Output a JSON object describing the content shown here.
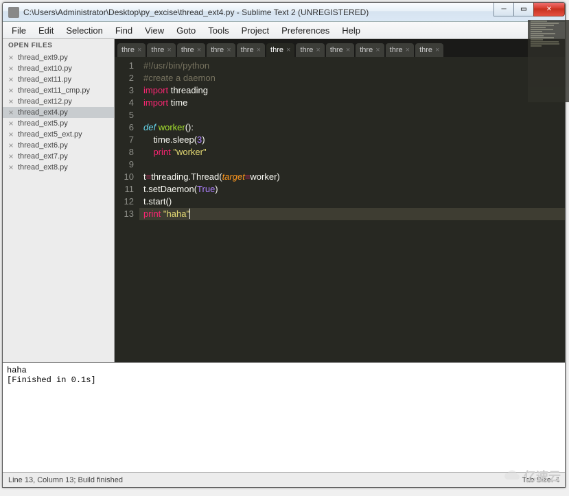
{
  "window": {
    "title": "C:\\Users\\Administrator\\Desktop\\py_excise\\thread_ext4.py - Sublime Text 2 (UNREGISTERED)"
  },
  "menu": {
    "items": [
      "File",
      "Edit",
      "Selection",
      "Find",
      "View",
      "Goto",
      "Tools",
      "Project",
      "Preferences",
      "Help"
    ]
  },
  "sidebar": {
    "header": "OPEN FILES",
    "items": [
      {
        "label": "thread_ext9.py",
        "active": false
      },
      {
        "label": "thread_ext10.py",
        "active": false
      },
      {
        "label": "thread_ext11.py",
        "active": false
      },
      {
        "label": "thread_ext11_cmp.py",
        "active": false
      },
      {
        "label": "thread_ext12.py",
        "active": false
      },
      {
        "label": "thread_ext4.py",
        "active": true
      },
      {
        "label": "thread_ext5.py",
        "active": false
      },
      {
        "label": "thread_ext5_ext.py",
        "active": false
      },
      {
        "label": "thread_ext6.py",
        "active": false
      },
      {
        "label": "thread_ext7.py",
        "active": false
      },
      {
        "label": "thread_ext8.py",
        "active": false
      }
    ]
  },
  "tabs": {
    "items": [
      {
        "label": "thre",
        "active": false
      },
      {
        "label": "thre",
        "active": false
      },
      {
        "label": "thre",
        "active": false
      },
      {
        "label": "thre",
        "active": false
      },
      {
        "label": "thre",
        "active": false
      },
      {
        "label": "thre",
        "active": true
      },
      {
        "label": "thre",
        "active": false
      },
      {
        "label": "thre",
        "active": false
      },
      {
        "label": "thre",
        "active": false
      },
      {
        "label": "thre",
        "active": false
      },
      {
        "label": "thre",
        "active": false
      }
    ]
  },
  "code": {
    "lines": [
      {
        "n": 1,
        "tokens": [
          {
            "t": "#!/usr/bin/python",
            "c": "comment"
          }
        ]
      },
      {
        "n": 2,
        "tokens": [
          {
            "t": "#create a daemon",
            "c": "comment"
          }
        ]
      },
      {
        "n": 3,
        "tokens": [
          {
            "t": "import",
            "c": "kw-red"
          },
          {
            "t": " threading",
            "c": ""
          }
        ]
      },
      {
        "n": 4,
        "tokens": [
          {
            "t": "import",
            "c": "kw-red"
          },
          {
            "t": " time",
            "c": ""
          }
        ]
      },
      {
        "n": 5,
        "tokens": []
      },
      {
        "n": 6,
        "tokens": [
          {
            "t": "def",
            "c": "kw-blue"
          },
          {
            "t": " ",
            "c": ""
          },
          {
            "t": "worker",
            "c": "fn-green"
          },
          {
            "t": "():",
            "c": ""
          }
        ]
      },
      {
        "n": 7,
        "tokens": [
          {
            "t": "    time.sleep(",
            "c": ""
          },
          {
            "t": "3",
            "c": "num"
          },
          {
            "t": ")",
            "c": ""
          }
        ]
      },
      {
        "n": 8,
        "tokens": [
          {
            "t": "    ",
            "c": ""
          },
          {
            "t": "print",
            "c": "kw-red"
          },
          {
            "t": " ",
            "c": ""
          },
          {
            "t": "\"worker\"",
            "c": "str"
          }
        ]
      },
      {
        "n": 9,
        "tokens": []
      },
      {
        "n": 10,
        "tokens": [
          {
            "t": "t",
            "c": ""
          },
          {
            "t": "=",
            "c": "kw-red"
          },
          {
            "t": "threading.Thread(",
            "c": ""
          },
          {
            "t": "target",
            "c": "param"
          },
          {
            "t": "=",
            "c": "kw-red"
          },
          {
            "t": "worker)",
            "c": ""
          }
        ]
      },
      {
        "n": 11,
        "tokens": [
          {
            "t": "t.setDaemon(",
            "c": ""
          },
          {
            "t": "True",
            "c": "num"
          },
          {
            "t": ")",
            "c": ""
          }
        ]
      },
      {
        "n": 12,
        "tokens": [
          {
            "t": "t.start()",
            "c": ""
          }
        ]
      },
      {
        "n": 13,
        "tokens": [
          {
            "t": "print",
            "c": "kw-red"
          },
          {
            "t": " ",
            "c": ""
          },
          {
            "t": "\"haha\"",
            "c": "str"
          }
        ],
        "cursor": true,
        "highlight": true
      }
    ]
  },
  "console": {
    "text": "haha\n[Finished in 0.1s]"
  },
  "status": {
    "left": "Line 13, Column 13; Build finished",
    "right": "Tab Size: 4"
  },
  "watermark": {
    "text": "亿速云"
  }
}
